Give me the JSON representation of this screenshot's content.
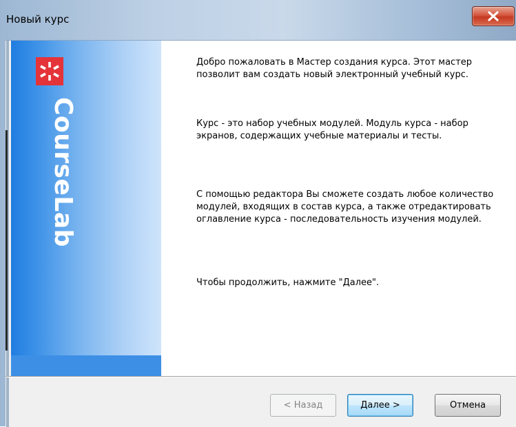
{
  "window": {
    "title": "Новый курс",
    "close_icon": "close-icon"
  },
  "sidebar": {
    "brand": "CourseLab",
    "logo_icon": "courselab-asterisk-logo",
    "colors": {
      "logo_red": "#e4343a",
      "gradient_start": "#1f7de0",
      "gradient_end": "#cfe4fb"
    }
  },
  "content": {
    "paragraphs": [
      "Добро пожаловать в Мастер создания курса. Этот мастер позволит вам создать новый электронный учебный курс.",
      "Курс - это набор учебных модулей. Модуль курса - набор экранов, содержащих учебные материалы и тесты.",
      "С помощью редактора Вы сможете создать любое количество модулей, входящих в состав курса, а также отредактировать оглавление курса  - последовательность изучения модулей.",
      "Чтобы продолжить, нажмите \"Далее\"."
    ]
  },
  "buttons": {
    "back": "< Назад",
    "next": "Далее >",
    "cancel": "Отмена"
  }
}
